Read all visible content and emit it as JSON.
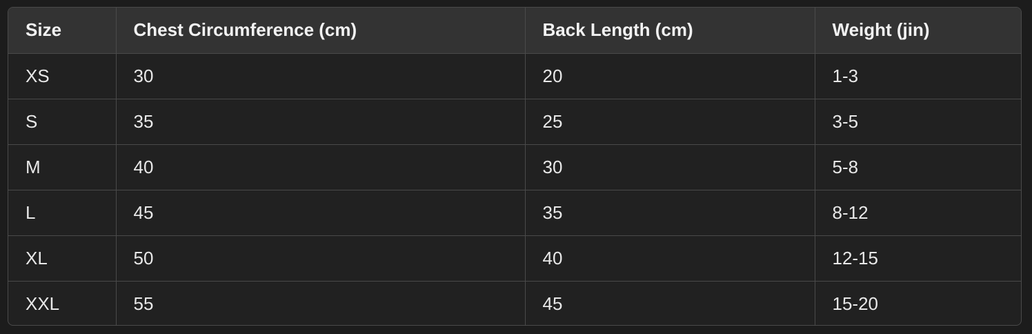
{
  "table": {
    "headers": [
      "Size",
      "Chest Circumference (cm)",
      "Back Length (cm)",
      "Weight (jin)"
    ],
    "rows": [
      [
        "XS",
        "30",
        "20",
        "1-3"
      ],
      [
        "S",
        "35",
        "25",
        "3-5"
      ],
      [
        "M",
        "40",
        "30",
        "5-8"
      ],
      [
        "L",
        "45",
        "35",
        "8-12"
      ],
      [
        "XL",
        "50",
        "40",
        "12-15"
      ],
      [
        "XXL",
        "55",
        "45",
        "15-20"
      ]
    ]
  },
  "colors": {
    "page_background": "#1c1c1c",
    "table_background": "#212121",
    "header_background": "#333333",
    "border": "#4a4a4a",
    "text": "#ececec"
  }
}
